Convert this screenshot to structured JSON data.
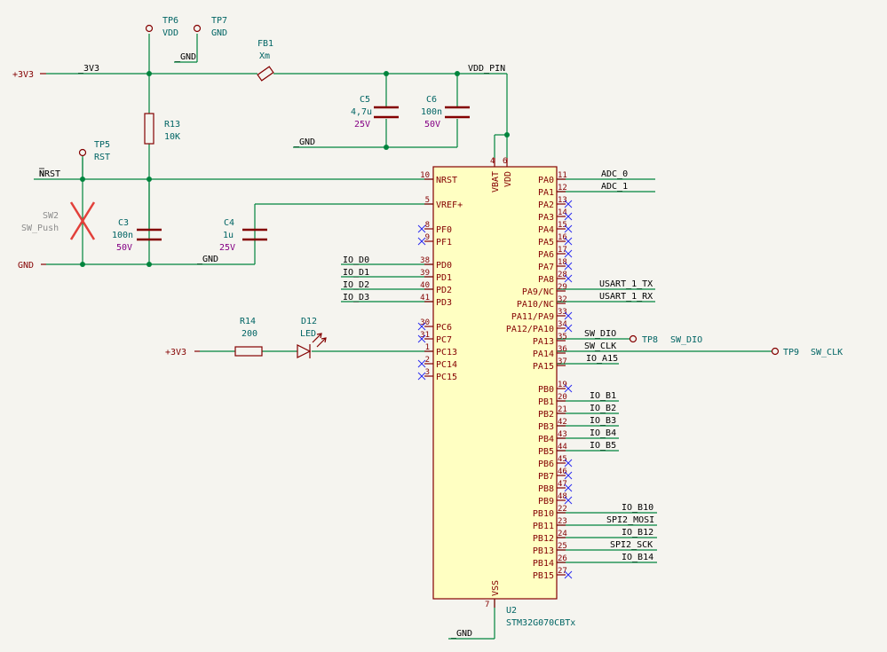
{
  "power": {
    "p3v3_left": "+3V3",
    "p3v3_led": "+3V3",
    "gnd_left": "GND"
  },
  "nets": {
    "n3v3": "_3V3",
    "gnd_tp7": "_GND",
    "vdd_pin": "VDD_PIN",
    "gnd_caps": "_GND",
    "nrst": "~{NRST}",
    "gnd_rst": "_GND",
    "gnd_vss": "_GND",
    "io_d0": "IO_D0",
    "io_d1": "IO_D1",
    "io_d2": "IO_D2",
    "io_d3": "IO_D3",
    "adc0": "ADC_0",
    "adc1": "ADC_1",
    "usart_tx": "USART_1_TX",
    "usart_rx": "USART_1_RX",
    "sw_dio": "SW_DIO",
    "sw_clk": "SW_CLK",
    "io_a15": "IO_A15",
    "io_b1": "IO_B1",
    "io_b2": "IO_B2",
    "io_b3": "IO_B3",
    "io_b4": "IO_B4",
    "io_b5": "IO_B5",
    "io_b10": "IO_B10",
    "spi2_mosi": "SPI2_MOSI",
    "io_b12": "IO_B12",
    "spi2_sck": "SPI2_SCK",
    "io_b14": "IO_B14"
  },
  "components": {
    "tp6": {
      "ref": "TP6",
      "val": "VDD"
    },
    "tp7": {
      "ref": "TP7",
      "val": "GND"
    },
    "tp5": {
      "ref": "TP5",
      "val": "RST"
    },
    "tp8": {
      "ref": "TP8",
      "val": "SW_DIO"
    },
    "tp9": {
      "ref": "TP9",
      "val": "SW_CLK"
    },
    "fb1": {
      "ref": "FB1",
      "val": "Xm"
    },
    "r13": {
      "ref": "R13",
      "val": "10K"
    },
    "c3": {
      "ref": "C3",
      "val": "100n",
      "volt": "50V"
    },
    "c4": {
      "ref": "C4",
      "val": "1u",
      "volt": "25V"
    },
    "c5": {
      "ref": "C5",
      "val": "4,7u",
      "volt": "25V"
    },
    "c6": {
      "ref": "C6",
      "val": "100n",
      "volt": "50V"
    },
    "sw2": {
      "ref": "SW2",
      "val": "SW_Push"
    },
    "r14": {
      "ref": "R14",
      "val": "200"
    },
    "d12": {
      "ref": "D12",
      "val": "LED"
    },
    "u2": {
      "ref": "U2",
      "val": "STM32G070CBTx"
    }
  },
  "mcu": {
    "left_pins": [
      {
        "name": "NRST",
        "num": "10"
      },
      {
        "name": "VREF+",
        "num": "5"
      },
      {
        "name": "PF0",
        "num": "8"
      },
      {
        "name": "PF1",
        "num": "9"
      },
      {
        "name": "PD0",
        "num": "38"
      },
      {
        "name": "PD1",
        "num": "39"
      },
      {
        "name": "PD2",
        "num": "40"
      },
      {
        "name": "PD3",
        "num": "41"
      },
      {
        "name": "PC6",
        "num": "30"
      },
      {
        "name": "PC7",
        "num": "31"
      },
      {
        "name": "PC13",
        "num": "1"
      },
      {
        "name": "PC14",
        "num": "2"
      },
      {
        "name": "PC15",
        "num": "3"
      }
    ],
    "right_pins": [
      {
        "name": "PA0",
        "num": "11"
      },
      {
        "name": "PA1",
        "num": "12"
      },
      {
        "name": "PA2",
        "num": "13"
      },
      {
        "name": "PA3",
        "num": "14"
      },
      {
        "name": "PA4",
        "num": "15"
      },
      {
        "name": "PA5",
        "num": "16"
      },
      {
        "name": "PA6",
        "num": "17"
      },
      {
        "name": "PA7",
        "num": "18"
      },
      {
        "name": "PA8",
        "num": "28"
      },
      {
        "name": "PA9/NC",
        "num": "29"
      },
      {
        "name": "PA10/NC",
        "num": "32"
      },
      {
        "name": "PA11/PA9",
        "num": "33"
      },
      {
        "name": "PA12/PA10",
        "num": "34"
      },
      {
        "name": "PA13",
        "num": "35"
      },
      {
        "name": "PA14",
        "num": "36"
      },
      {
        "name": "PA15",
        "num": "37"
      },
      {
        "name": "PB0",
        "num": "19"
      },
      {
        "name": "PB1",
        "num": "20"
      },
      {
        "name": "PB2",
        "num": "21"
      },
      {
        "name": "PB3",
        "num": "42"
      },
      {
        "name": "PB4",
        "num": "43"
      },
      {
        "name": "PB5",
        "num": "44"
      },
      {
        "name": "PB6",
        "num": "45"
      },
      {
        "name": "PB7",
        "num": "46"
      },
      {
        "name": "PB8",
        "num": "47"
      },
      {
        "name": "PB9",
        "num": "48"
      },
      {
        "name": "PB10",
        "num": "22"
      },
      {
        "name": "PB11",
        "num": "23"
      },
      {
        "name": "PB12",
        "num": "24"
      },
      {
        "name": "PB13",
        "num": "25"
      },
      {
        "name": "PB14",
        "num": "26"
      },
      {
        "name": "PB15",
        "num": "27"
      }
    ],
    "top_pins": [
      {
        "name": "VBAT",
        "num": "4"
      },
      {
        "name": "VDD",
        "num": "6"
      }
    ],
    "bottom_pins": [
      {
        "name": "VSS",
        "num": "7"
      }
    ]
  }
}
